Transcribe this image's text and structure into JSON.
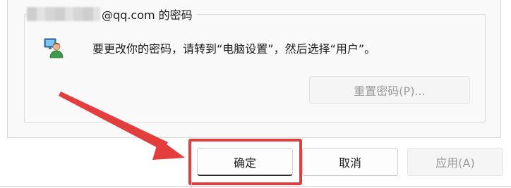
{
  "account": {
    "email_suffix": "@qq.com 的密码"
  },
  "message": "要更改你的密码，请转到“电脑设置”，然后选择“用户”。",
  "buttons": {
    "reset_password": "重置密码(P)...",
    "ok": "确定",
    "cancel": "取消",
    "apply": "应用(A)"
  },
  "icons": {
    "user": "user-icon"
  },
  "colors": {
    "annotation": "#e43d3d"
  }
}
